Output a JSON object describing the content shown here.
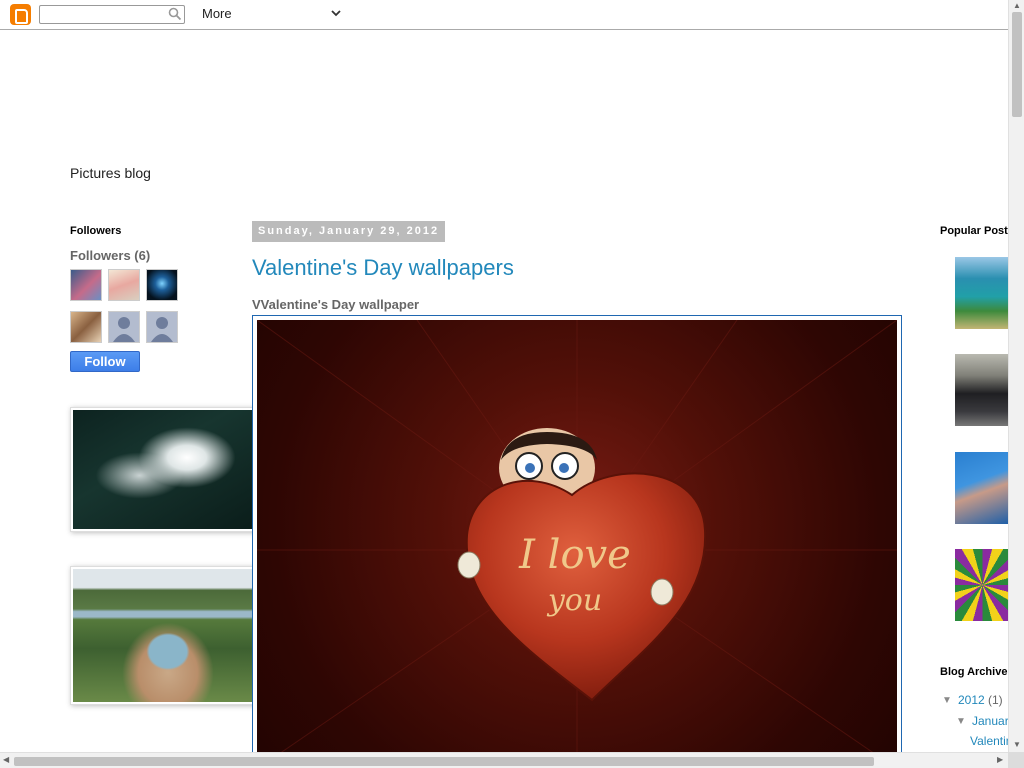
{
  "navbar": {
    "more_label": "More",
    "search_placeholder": ""
  },
  "header": {
    "blog_title": "Pictures blog"
  },
  "sidebar_left": {
    "followers_title": "Followers",
    "followers_count": "Followers (6)",
    "follow_label": "Follow"
  },
  "post": {
    "date": "Sunday, January 29, 2012",
    "title": "Valentine's Day wallpapers",
    "body_text": "VValentine's Day wallpaper",
    "image_text_line1": "I love",
    "image_text_line2": "you"
  },
  "sidebar_right": {
    "popular_title": "Popular Posts",
    "archive_title": "Blog Archive",
    "archive_year": "2012",
    "archive_year_count": "(1)",
    "archive_month": "January",
    "archive_post": "Valentine's Day wallpapers"
  },
  "colors": {
    "link": "#2288bb",
    "follow_button": "#4a8cf0",
    "image_frame": "#1f67b1"
  }
}
